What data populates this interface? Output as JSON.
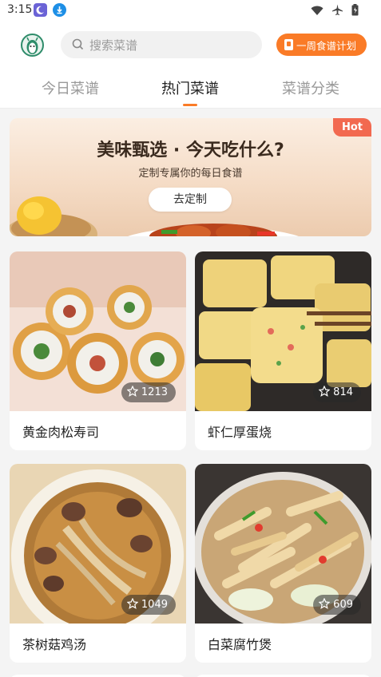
{
  "status_bar": {
    "time": "3:15"
  },
  "header": {
    "search_placeholder": "搜索菜谱",
    "plan_button_label": "一周食谱计划"
  },
  "tabs": [
    {
      "label": "今日菜谱",
      "active": false
    },
    {
      "label": "热门菜谱",
      "active": true
    },
    {
      "label": "菜谱分类",
      "active": false
    }
  ],
  "banner": {
    "title": "美味甄选 · 今天吃什么?",
    "subtitle": "定制专属你的每日食谱",
    "button_label": "去定制",
    "badge": "Hot"
  },
  "recipes": [
    {
      "name": "黄金肉松寿司",
      "favorites": "1213"
    },
    {
      "name": "虾仁厚蛋烧",
      "favorites": "814"
    },
    {
      "name": "茶树菇鸡汤",
      "favorites": "1049"
    },
    {
      "name": "白菜腐竹煲",
      "favorites": "609"
    }
  ],
  "colors": {
    "accent": "#fa7b27",
    "hot_badge": "#f26950"
  }
}
